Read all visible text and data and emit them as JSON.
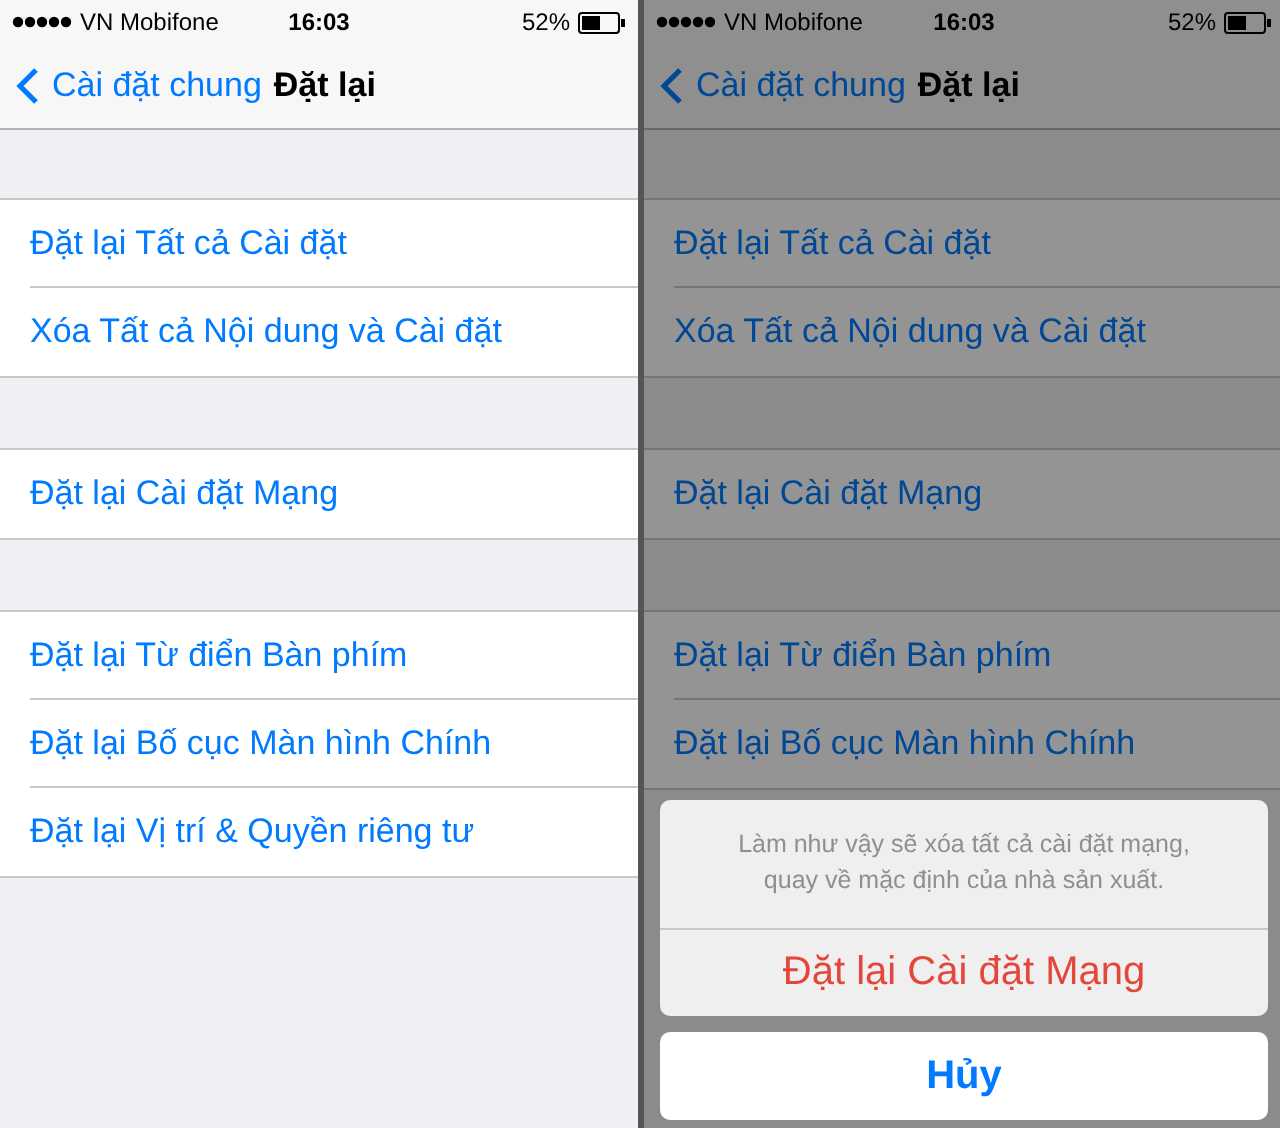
{
  "screens": [
    {
      "dimmed": false,
      "status_bar": {
        "carrier": "VN Mobifone",
        "time": "16:03",
        "battery": "52%"
      },
      "nav": {
        "back": "Cài đặt chung",
        "title": "Đặt lại"
      },
      "groups": [
        [
          "Đặt lại Tất cả Cài đặt",
          "Xóa Tất cả Nội dung và Cài đặt"
        ],
        [
          "Đặt lại Cài đặt Mạng"
        ],
        [
          "Đặt lại Từ điển Bàn phím",
          "Đặt lại Bố cục Màn hình Chính",
          "Đặt lại Vị trí & Quyền riêng tư"
        ]
      ]
    },
    {
      "dimmed": true,
      "status_bar": {
        "carrier": "VN Mobifone",
        "time": "16:03",
        "battery": "52%"
      },
      "nav": {
        "back": "Cài đặt chung",
        "title": "Đặt lại"
      },
      "groups": [
        [
          "Đặt lại Tất cả Cài đặt",
          "Xóa Tất cả Nội dung và Cài đặt"
        ],
        [
          "Đặt lại Cài đặt Mạng"
        ],
        [
          "Đặt lại Từ điển Bàn phím",
          "Đặt lại Bố cục Màn hình Chính"
        ]
      ],
      "action_sheet": {
        "message": "Làm như vậy sẽ xóa tất cả cài đặt mạng, quay về mặc định của nhà sản xuất.",
        "destructive": "Đặt lại Cài đặt Mạng",
        "cancel": "Hủy"
      }
    }
  ]
}
